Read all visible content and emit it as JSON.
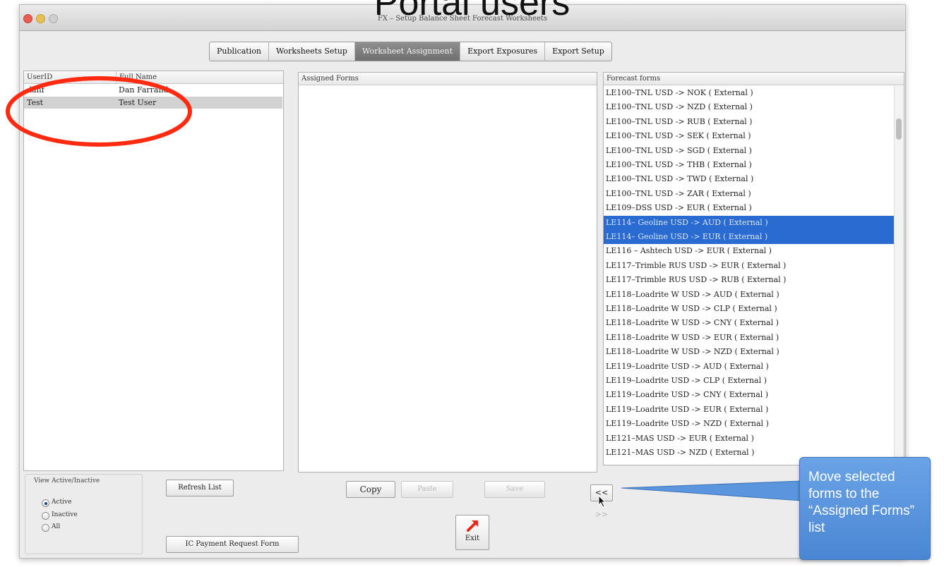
{
  "slide_title": "Portal users",
  "window": {
    "title": "FX – Setup Balance Sheet Forecast Worksheets"
  },
  "tabs": [
    {
      "label": "Publication",
      "active": false
    },
    {
      "label": "Worksheets Setup",
      "active": false
    },
    {
      "label": "Worksheet Assignment",
      "active": true
    },
    {
      "label": "Export Exposures",
      "active": false
    },
    {
      "label": "Export Setup",
      "active": false
    }
  ],
  "users": {
    "headers": {
      "user_id": "UserID",
      "full_name": "Full Name"
    },
    "rows": [
      {
        "user_id": "danf",
        "full_name": "Dan Farrand",
        "selected": false
      },
      {
        "user_id": "Test",
        "full_name": "Test User",
        "selected": true
      }
    ]
  },
  "assigned": {
    "header": "Assigned Forms"
  },
  "forecast": {
    "header": "Forecast forms",
    "items": [
      {
        "label": "LE100–TNL USD -> NOK ( External )",
        "selected": false
      },
      {
        "label": "LE100–TNL USD -> NZD ( External )",
        "selected": false
      },
      {
        "label": "LE100–TNL USD -> RUB ( External )",
        "selected": false
      },
      {
        "label": "LE100–TNL USD -> SEK ( External )",
        "selected": false
      },
      {
        "label": "LE100–TNL USD -> SGD ( External )",
        "selected": false
      },
      {
        "label": "LE100–TNL USD -> THB ( External )",
        "selected": false
      },
      {
        "label": "LE100–TNL USD -> TWD ( External )",
        "selected": false
      },
      {
        "label": "LE100–TNL USD -> ZAR ( External )",
        "selected": false
      },
      {
        "label": "LE109–DSS USD -> EUR ( External )",
        "selected": false
      },
      {
        "label": "LE114– Geoline USD -> AUD ( External )",
        "selected": true
      },
      {
        "label": "LE114– Geoline USD -> EUR ( External )",
        "selected": true
      },
      {
        "label": "LE116 – Ashtech USD -> EUR ( External )",
        "selected": false
      },
      {
        "label": "LE117–Trimble RUS USD -> EUR ( External )",
        "selected": false
      },
      {
        "label": "LE117–Trimble RUS USD -> RUB ( External )",
        "selected": false
      },
      {
        "label": "LE118–Loadrite W USD -> AUD ( External )",
        "selected": false
      },
      {
        "label": "LE118–Loadrite W USD -> CLP ( External )",
        "selected": false
      },
      {
        "label": "LE118–Loadrite W USD -> CNY ( External )",
        "selected": false
      },
      {
        "label": "LE118–Loadrite W USD -> EUR ( External )",
        "selected": false
      },
      {
        "label": "LE118–Loadrite W USD -> NZD ( External )",
        "selected": false
      },
      {
        "label": "LE119–Loadrite USD -> AUD ( External )",
        "selected": false
      },
      {
        "label": "LE119–Loadrite USD -> CLP ( External )",
        "selected": false
      },
      {
        "label": "LE119–Loadrite USD -> CNY ( External )",
        "selected": false
      },
      {
        "label": "LE119–Loadrite USD -> EUR ( External )",
        "selected": false
      },
      {
        "label": "LE119–Loadrite USD -> NZD ( External )",
        "selected": false
      },
      {
        "label": "LE121–MAS USD -> EUR ( External )",
        "selected": false
      },
      {
        "label": "LE121–MAS USD -> NZD ( External )",
        "selected": false
      }
    ]
  },
  "view_filter": {
    "label": "View Active/Inactive",
    "options": [
      {
        "label": "Active",
        "checked": true
      },
      {
        "label": "Inactive",
        "checked": false
      },
      {
        "label": "All",
        "checked": false
      }
    ]
  },
  "buttons": {
    "refresh": "Refresh List",
    "ic_payment": "IC Payment Request Form",
    "copy": "Copy",
    "paste": "Paste",
    "save": "Save",
    "move_left": "<<",
    "move_right": ">>",
    "exit": "Exit"
  },
  "callout": {
    "text": "Move selected forms to the “Assigned Forms” list"
  },
  "colors": {
    "selection_blue": "#2a6bd1",
    "annotation_red": "#ff2a10",
    "callout_blue": "#5a95dd"
  }
}
